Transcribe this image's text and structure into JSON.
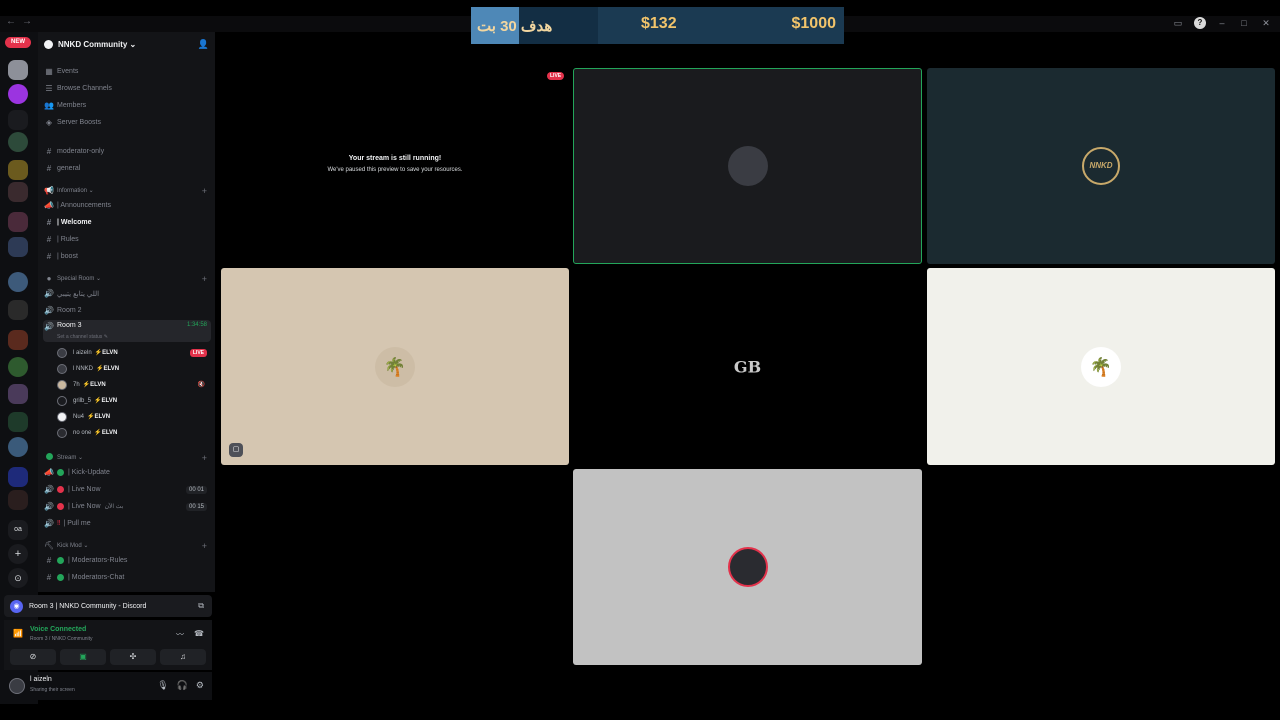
{
  "titlebar": {
    "back": "←",
    "forward": "→"
  },
  "donation": {
    "goal_text": "هدف 30 بت",
    "goal_fill_fraction": 0.38,
    "current": "$132",
    "target": "$1000"
  },
  "rail": {
    "new_label": "NEW"
  },
  "server": {
    "name": "NNKD Community ⌄"
  },
  "channels": {
    "events": "Events",
    "browse": "Browse Channels",
    "members": "Members",
    "boosts": "Server Boosts",
    "moderator_only": "moderator-only",
    "general": "general",
    "cat_information": "Information ⌄",
    "announcements": "| Announcements",
    "welcome": "| Welcome",
    "rules": "| Rules",
    "boost": "| boost",
    "cat_special": "Special Room ⌄",
    "special_arabic": "اللي يتابع يتيبي",
    "room2": "Room 2",
    "room3": "Room 3",
    "room3_time": "1:34:58",
    "room3_status": "Set a channel status ✎",
    "cat_stream": "Stream ⌄",
    "kick_update": "| Kick-Update",
    "live_now_1": "| Live Now",
    "live_now_1_count": "00 01",
    "live_now_2": "| Live Now",
    "live_now_2_extra": "بث الآن",
    "live_now_2_count": "00 15",
    "pull_me": "| Pull me",
    "cat_kick_mod": "Kick Mod ⌄",
    "moderators_rules": "| Moderators-Rules",
    "moderators_chat": "| Moderators-Chat"
  },
  "voice_users": [
    {
      "name": "l aizeln",
      "tag": "⚡ELVN",
      "live": "LIVE"
    },
    {
      "name": "l NNKD",
      "tag": "⚡ELVN"
    },
    {
      "name": "7h",
      "tag": "⚡ELVN"
    },
    {
      "name": "grilb_5",
      "tag": "⚡ELVN"
    },
    {
      "name": "Nu4",
      "tag": "⚡ELVN"
    },
    {
      "name": "no one",
      "tag": "⚡ELVN"
    }
  ],
  "stream_popout": {
    "title": "Room 3 | NNKD Community - Discord"
  },
  "voice_panel": {
    "title": "Voice Connected",
    "subtitle": "Room 3 / NNKD Community"
  },
  "user_panel": {
    "name": "l aizeln",
    "status": "Sharing their screen"
  },
  "stage": {
    "paused_title": "Your stream is still running!",
    "paused_sub": "We've paused this preview to save your resources.",
    "live_label": "LIVE",
    "gb_text": "GB",
    "nnkd_text": "NNKD"
  },
  "colors": {
    "accent": "#5865f2",
    "online": "#23a55a",
    "live": "#e3324b",
    "gold": "#f2c46b"
  }
}
